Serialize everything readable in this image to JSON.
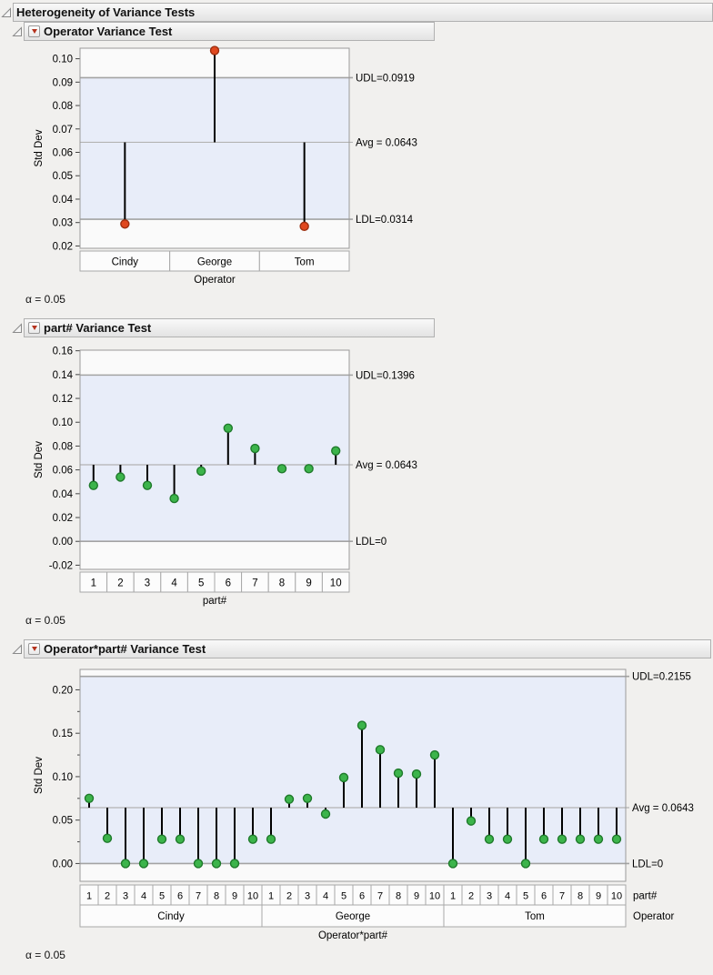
{
  "report": {
    "title": "Heterogeneity of Variance Tests"
  },
  "sections": [
    {
      "title": "Operator Variance Test",
      "alpha_note": "α = 0.05"
    },
    {
      "title": "part# Variance Test",
      "alpha_note": "α = 0.05"
    },
    {
      "title": "Operator*part# Variance Test",
      "alpha_note": "α = 0.05"
    }
  ],
  "colors": {
    "band": "#e8edf9",
    "plot_bg": "#fafafa",
    "limit_line": "#a3a3a3",
    "avg_line": "#b3b3b3",
    "plot_border": "#9a9a9a",
    "needle": "#000000",
    "tick": "#444444",
    "cell_bg": "#fcfcfc",
    "cell_border": "#a8a8a8",
    "red_point": "#e0481f",
    "red_point_edge": "#9c2f10",
    "green_point": "#3cb44b",
    "green_point_edge": "#1f7a2b",
    "red_triangle": "#b5331e"
  },
  "chart_data": [
    {
      "type": "needle",
      "title": "Operator Variance Test",
      "ylabel": "Std Dev",
      "xlabel": "Operator",
      "categories": [
        "Cindy",
        "George",
        "Tom"
      ],
      "values": [
        0.0294,
        0.1035,
        0.0284
      ],
      "avg": 0.0643,
      "udl": 0.0919,
      "ldl": 0.0314,
      "right_labels": {
        "udl": "UDL=0.0919",
        "avg": "Avg = 0.0643",
        "ldl": "LDL=0.0314"
      },
      "ylim": [
        0.019,
        0.1045
      ],
      "yticks": [
        0.02,
        0.03,
        0.04,
        0.05,
        0.06,
        0.07,
        0.08,
        0.09,
        0.1
      ],
      "ytick_decimals": 2,
      "point_style": "red",
      "alpha": 0.05
    },
    {
      "type": "needle",
      "title": "part# Variance Test",
      "ylabel": "Std Dev",
      "xlabel": "part#",
      "categories": [
        "1",
        "2",
        "3",
        "4",
        "5",
        "6",
        "7",
        "8",
        "9",
        "10"
      ],
      "values": [
        0.047,
        0.054,
        0.047,
        0.036,
        0.059,
        0.095,
        0.078,
        0.061,
        0.061,
        0.076
      ],
      "avg": 0.0643,
      "udl": 0.1396,
      "ldl": 0,
      "right_labels": {
        "udl": "UDL=0.1396",
        "avg": "Avg = 0.0643",
        "ldl": "LDL=0"
      },
      "ylim": [
        -0.0235,
        0.1605
      ],
      "yticks": [
        -0.02,
        0.0,
        0.02,
        0.04,
        0.06,
        0.08,
        0.1,
        0.12,
        0.14,
        0.16
      ],
      "ytick_decimals": 2,
      "point_style": "green",
      "alpha": 0.05
    },
    {
      "type": "needle-grouped",
      "title": "Operator*part# Variance Test",
      "ylabel": "Std Dev",
      "xlabel": "Operator*part#",
      "part_axis_label": "part#",
      "group_axis_label": "Operator",
      "part_labels": [
        "1",
        "2",
        "3",
        "4",
        "5",
        "6",
        "7",
        "8",
        "9",
        "10"
      ],
      "groups": [
        {
          "label": "Cindy",
          "values": [
            0.075,
            0.029,
            0,
            0,
            0.028,
            0.028,
            0,
            0,
            0,
            0.028
          ]
        },
        {
          "label": "George",
          "values": [
            0.028,
            0.074,
            0.075,
            0.057,
            0.099,
            0.159,
            0.131,
            0.104,
            0.103,
            0.125
          ]
        },
        {
          "label": "Tom",
          "values": [
            0,
            0.049,
            0.028,
            0.028,
            0,
            0.028,
            0.028,
            0.028,
            0.028,
            0.028
          ]
        }
      ],
      "avg": 0.0643,
      "udl": 0.2155,
      "ldl": 0,
      "right_labels": {
        "udl": "UDL=0.2155",
        "avg": "Avg = 0.0643",
        "ldl": "LDL=0"
      },
      "ylim": [
        -0.0205,
        0.2235
      ],
      "yticks": [
        0.0,
        0.05,
        0.1,
        0.15,
        0.2
      ],
      "yminor": [
        0.025,
        0.075,
        0.125,
        0.175
      ],
      "ytick_decimals": 2,
      "point_style": "green",
      "alpha": 0.05
    }
  ]
}
